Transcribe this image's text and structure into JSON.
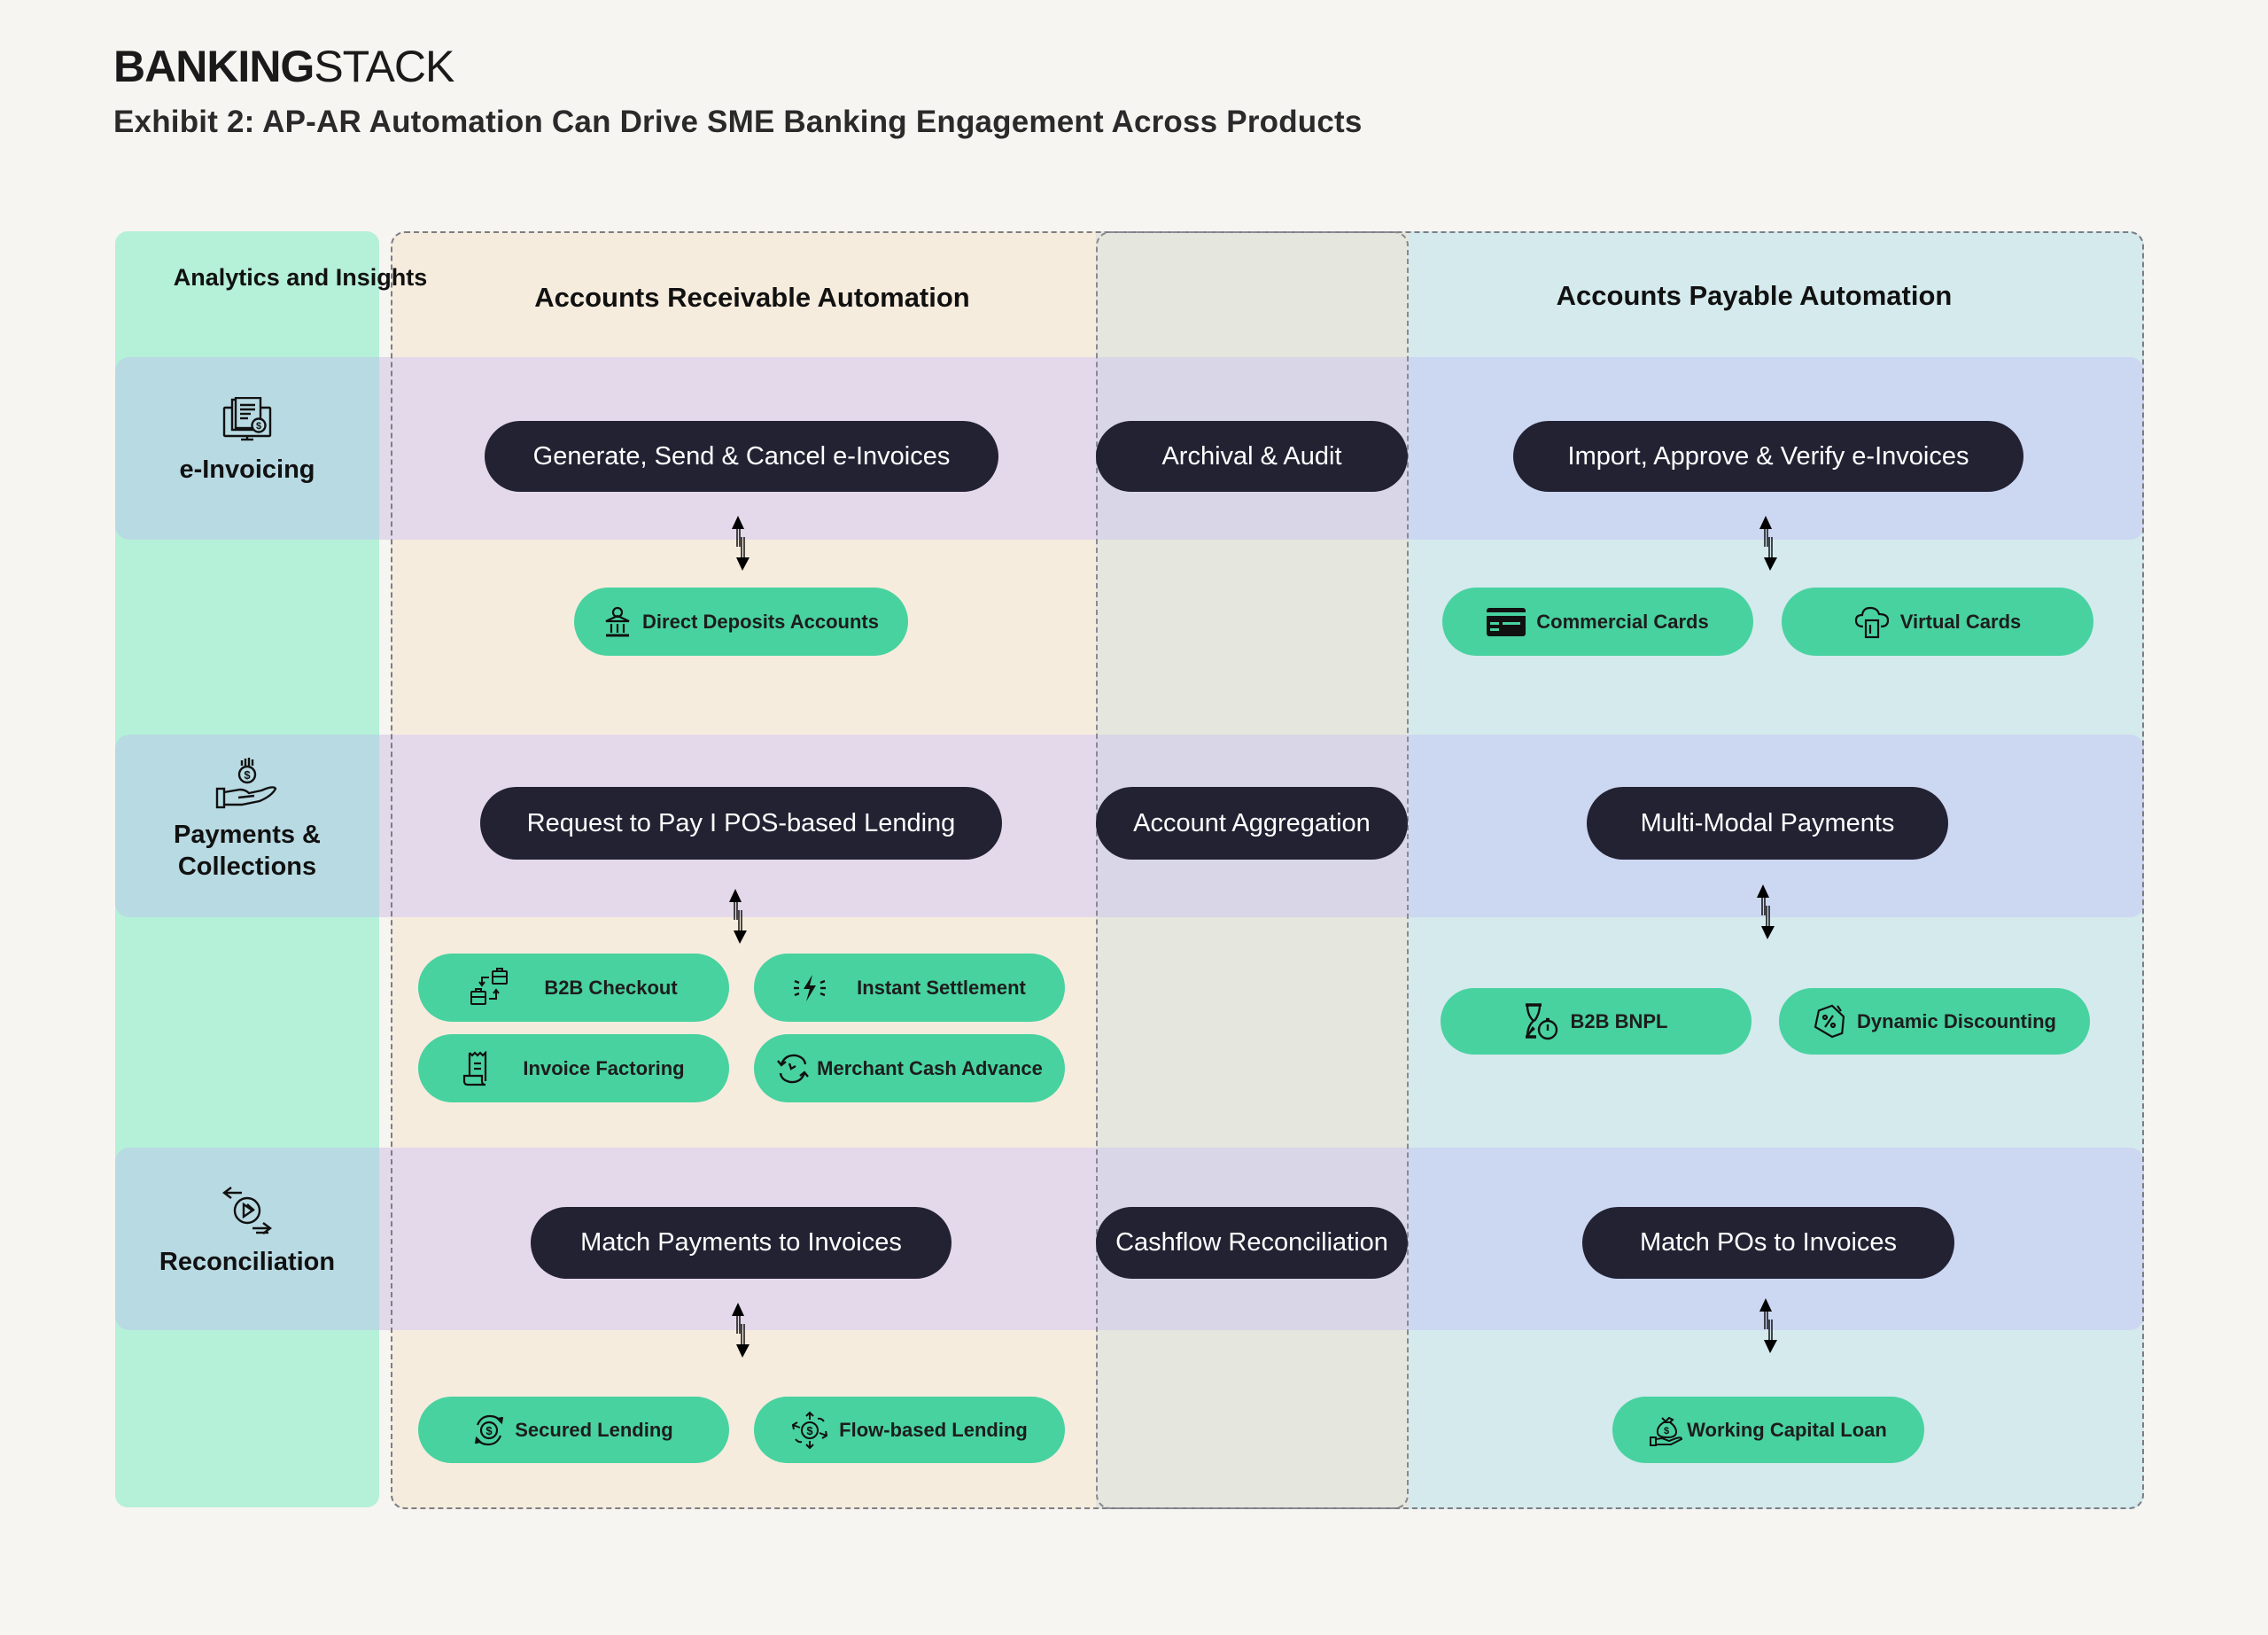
{
  "brand": {
    "bold": "BANKING",
    "light": "STACK"
  },
  "title": "Exhibit 2: AP-AR Automation Can Drive SME Banking Engagement Across Products",
  "columns": {
    "left": "Analytics and Insights",
    "ar": "Accounts Receivable Automation",
    "ap": "Accounts Payable Automation"
  },
  "colors": {
    "dark_pill": "#232233",
    "green_pill": "#48d2a0",
    "left_column": "#b5f0d8",
    "ar_column": "#f6ecdd",
    "middle_column": "#e5e6dd",
    "ap_column": "#d4eaed",
    "row_band_left": "#b8dae3",
    "row_band_ar": "#e4d9ea",
    "row_band_ap": "#ccd7f1"
  },
  "rows": [
    {
      "category": "e-Invoicing",
      "icon": "invoice-monitor-icon",
      "ar_process": "Generate, Send & Cancel e-Invoices",
      "shared_process": "Archival & Audit",
      "ap_process": "Import, Approve & Verify e-Invoices",
      "ar_products": [
        {
          "label": "Direct Deposits Accounts",
          "icon": "bank-icon"
        }
      ],
      "ap_products": [
        {
          "label": "Commercial Cards",
          "icon": "credit-card-icon"
        },
        {
          "label": "Virtual Cards",
          "icon": "cloud-card-icon"
        }
      ]
    },
    {
      "category": "Payments & Collections",
      "icon": "hand-coin-icon",
      "ar_process": "Request to Pay I POS-based Lending",
      "shared_process": "Account Aggregation",
      "ap_process": "Multi-Modal Payments",
      "ar_products": [
        {
          "label": "B2B Checkout",
          "icon": "briefcase-exchange-icon"
        },
        {
          "label": "Instant Settlement",
          "icon": "lightning-icon"
        },
        {
          "label": "Invoice Factoring",
          "icon": "receipt-icon"
        },
        {
          "label": "Merchant Cash Advance",
          "icon": "clock-cycle-icon"
        }
      ],
      "ap_products": [
        {
          "label": "B2B BNPL",
          "icon": "hourglass-timer-icon"
        },
        {
          "label": "Dynamic Discounting",
          "icon": "discount-tag-icon"
        }
      ]
    },
    {
      "category": "Reconciliation",
      "icon": "exchange-play-icon",
      "ar_process": "Match Payments to Invoices",
      "shared_process": "Cashflow Reconciliation",
      "ap_process": "Match POs to Invoices",
      "ar_products": [
        {
          "label": "Secured Lending",
          "icon": "coin-cycle-icon"
        },
        {
          "label": "Flow-based Lending",
          "icon": "coin-flow-icon"
        }
      ],
      "ap_products": [
        {
          "label": "Working Capital Loan",
          "icon": "money-bag-hand-icon"
        }
      ]
    }
  ]
}
